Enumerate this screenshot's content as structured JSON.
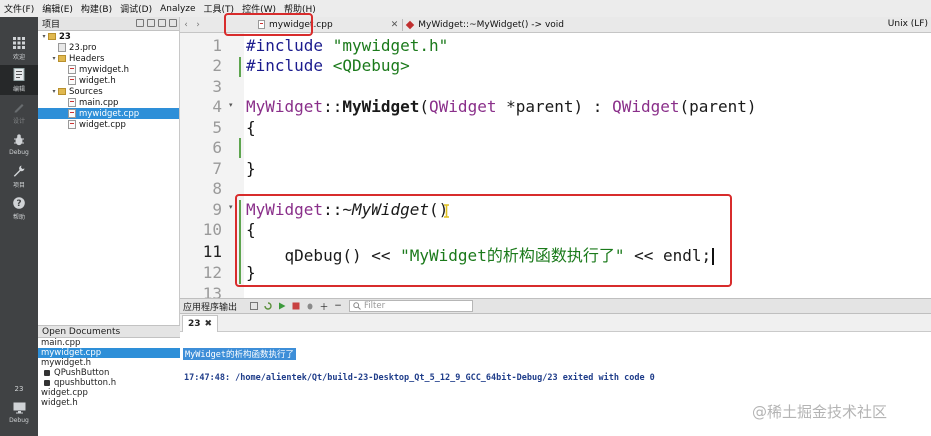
{
  "menu": [
    "文件(F)",
    "编辑(E)",
    "构建(B)",
    "调试(D)",
    "Analyze",
    "工具(T)",
    "控件(W)",
    "帮助(H)"
  ],
  "modes": [
    {
      "label": "欢迎",
      "icon": "grid-icon"
    },
    {
      "label": "编辑",
      "icon": "edit-doc-icon"
    },
    {
      "label": "设计",
      "icon": "design-pen-icon"
    },
    {
      "label": "Debug",
      "icon": "bug-icon"
    },
    {
      "label": "项目",
      "icon": "wrench-icon"
    },
    {
      "label": "帮助",
      "icon": "help-icon"
    }
  ],
  "kit": {
    "label": "23",
    "mode": "Debug"
  },
  "project_pane": {
    "title": "项目",
    "tree": [
      {
        "label": "23",
        "level": 0,
        "kind": "folder",
        "arrow": "▾",
        "bold": true
      },
      {
        "label": "23.pro",
        "level": 1,
        "kind": "pro",
        "arrow": ""
      },
      {
        "label": "Headers",
        "level": 1,
        "kind": "folder",
        "arrow": "▾"
      },
      {
        "label": "mywidget.h",
        "level": 2,
        "kind": "h",
        "arrow": ""
      },
      {
        "label": "widget.h",
        "level": 2,
        "kind": "h",
        "arrow": ""
      },
      {
        "label": "Sources",
        "level": 1,
        "kind": "folder",
        "arrow": "▾"
      },
      {
        "label": "main.cpp",
        "level": 2,
        "kind": "cpp",
        "arrow": ""
      },
      {
        "label": "mywidget.cpp",
        "level": 2,
        "kind": "cpp",
        "arrow": "",
        "selected": true
      },
      {
        "label": "widget.cpp",
        "level": 2,
        "kind": "cpp",
        "arrow": ""
      }
    ]
  },
  "open_documents": {
    "title": "Open Documents",
    "items": [
      {
        "label": "main.cpp"
      },
      {
        "label": "mywidget.cpp",
        "selected": true
      },
      {
        "label": "mywidget.h"
      },
      {
        "label": "QPushButton",
        "locked": true
      },
      {
        "label": "qpushbutton.h",
        "locked": true
      },
      {
        "label": "widget.cpp"
      },
      {
        "label": "widget.h"
      }
    ]
  },
  "editor": {
    "file_tab": "mywidget.cpp",
    "close_symbol": "✕",
    "symbol": "MyWidget::~MyWidget() -> void",
    "encoding": "Unix (LF)",
    "line_numbers": [
      "1",
      "2",
      "3",
      "4",
      "5",
      "6",
      "7",
      "8",
      "9",
      "10",
      "11",
      "12",
      "13"
    ],
    "current_line": "11",
    "code": {
      "l1_directive": "#include",
      "l1_header": "\"mywidget.h\"",
      "l2_directive": "#include",
      "l2_header": "<QDebug>",
      "l4_class": "MyWidget",
      "l4_scope": "::",
      "l4_ctor": "MyWidget",
      "l4_open": "(",
      "l4_qwidget": "QWidget",
      "l4_param": " *parent) : ",
      "l4_base": "QWidget",
      "l4_rest": "(parent)",
      "l5": "{",
      "l7": "}",
      "l9_class": "MyWidget",
      "l9_scope": "::~",
      "l9_dtor": "MyWidget",
      "l9_paren": "()",
      "l10": "{",
      "l11_indent": "    ",
      "l11_call": "qDebug() << ",
      "l11_str": "\"MyWidget的析构函数执行了\"",
      "l11_rest": " << endl;",
      "l12": "}"
    }
  },
  "output": {
    "title": "应用程序输出",
    "filter_placeholder": "Filter",
    "tab_label": "23",
    "tab_close": "✖",
    "line1": "MyWidget的析构函数执行了",
    "line2": "17:47:48: /home/alientek/Qt/build-23-Desktop_Qt_5_12_9_GCC_64bit-Debug/23 exited with code 0"
  },
  "watermark": "@稀土掘金技术社区",
  "colors": {
    "highlight_box": "#d82c2c",
    "selection": "#2e8fd8",
    "modebar": "#404244"
  }
}
